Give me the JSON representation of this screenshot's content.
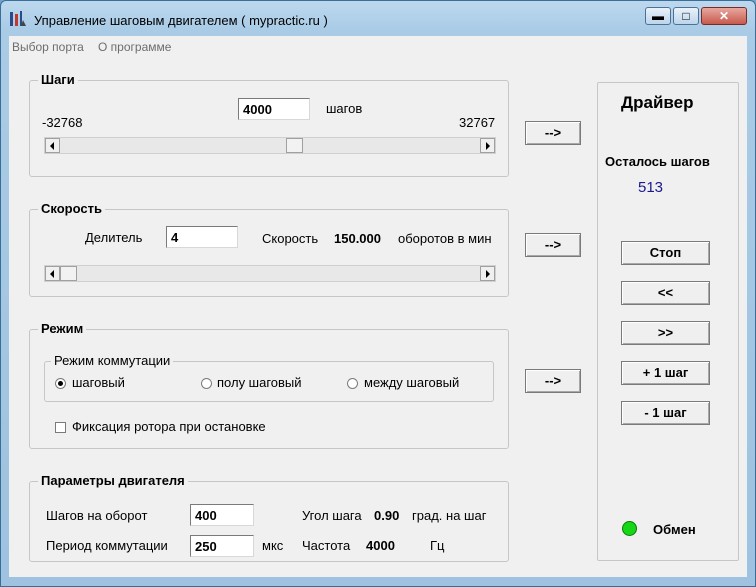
{
  "window": {
    "title": "Управление шаговым двигателем ( mypractic.ru )",
    "min": "▬",
    "max": "□",
    "close": "✕"
  },
  "menu": {
    "port": "Выбор порта",
    "about": "О программе"
  },
  "steps": {
    "title": "Шаги",
    "value": "4000",
    "unit": "шагов",
    "min": "-32768",
    "max": "32767",
    "slider_fraction": 0.56,
    "send_label": "-->"
  },
  "speed": {
    "title": "Скорость",
    "divider_label": "Делитель",
    "divider_value": "4",
    "speed_label": "Скорость",
    "speed_value": "150.000",
    "speed_unit": "оборотов в мин",
    "slider_fraction": 0.0,
    "send_label": "-->"
  },
  "mode": {
    "title": "Режим",
    "subgroup_title": "Режим коммутации",
    "options": [
      "шаговый",
      "полу шаговый",
      "между шаговый"
    ],
    "selected": 0,
    "hold_label": "Фиксация ротора при остановке",
    "hold_checked": false,
    "send_label": "-->"
  },
  "motor": {
    "title": "Параметры двигателя",
    "steps_per_rev_label": "Шагов на оборот",
    "steps_per_rev": "400",
    "angle_label": "Угол шага",
    "angle_value": "0.90",
    "angle_unit": "град. на шаг",
    "period_label": "Период коммутации",
    "period_value": "250",
    "period_unit": "мкс",
    "freq_label": "Частота",
    "freq_value": "4000",
    "freq_unit": "Гц"
  },
  "driver": {
    "title": "Драйвер",
    "remaining_label": "Осталось шагов",
    "remaining_value": "513",
    "stop": "Стоп",
    "back": "<<",
    "fwd": ">>",
    "plus_one": "+ 1 шаг",
    "minus_one": "- 1 шаг",
    "exchange_label": "Обмен",
    "led_color": "#16d716"
  },
  "colors": {
    "counter": "#1a1a8c"
  }
}
